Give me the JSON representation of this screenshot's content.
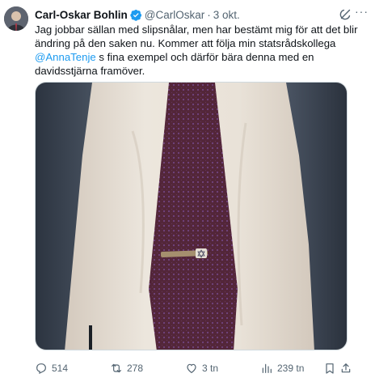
{
  "author": {
    "name": "Carl-Oskar Bohlin",
    "handle": "@CarlOskar",
    "separator": "·",
    "date": "3 okt.",
    "verified": true
  },
  "tweet": {
    "text_part1": "Jag jobbar sällan med slipsnålar, men har bestämt mig för att det blir ändring på den saken nu. Kommer att följa min statsrådskollega ",
    "mention": "@AnnaTenje",
    "text_part2": " s fina exempel och därför bära denna med en davidsstjärna framöver."
  },
  "media": {
    "description_icon": "photo-tie-with-star-of-david-clip"
  },
  "actions": {
    "replies": "514",
    "retweets": "278",
    "likes": "3 tn",
    "views": "239 tn"
  },
  "colors": {
    "accent": "#1d9bf0",
    "muted": "#536471",
    "text": "#0f1419",
    "tie": "#5a2a3c"
  }
}
